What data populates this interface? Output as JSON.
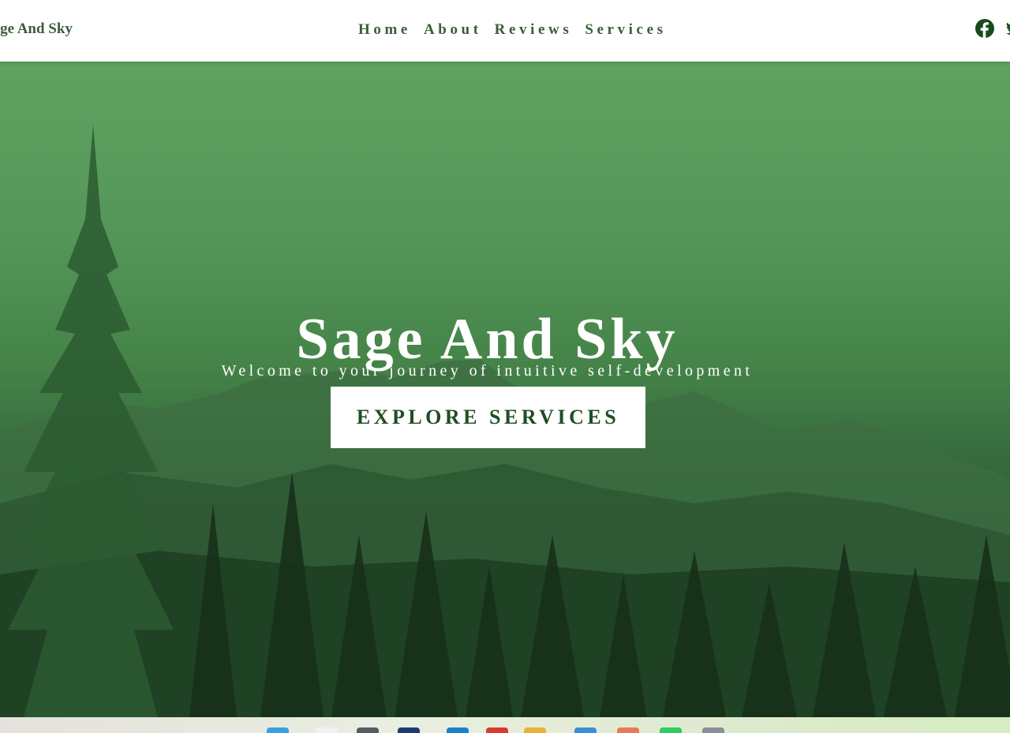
{
  "nav": {
    "brand": "Sage And Sky",
    "links": [
      {
        "label": "Home"
      },
      {
        "label": "About"
      },
      {
        "label": "Reviews"
      },
      {
        "label": "Services"
      }
    ],
    "social": [
      "facebook-icon",
      "twitter-icon"
    ]
  },
  "hero": {
    "title": "Sage And Sky",
    "subtitle": "Welcome to your journey of intuitive self-development",
    "cta_label": "EXPLORE SERVICES"
  },
  "colors": {
    "brand_green": "#3c5d3a",
    "cta_text": "#1f4d23",
    "hero_top": "#5ea25f",
    "hero_bottom": "#142a19"
  },
  "taskbar": {
    "icons": [
      "windows-start-icon",
      "file-icon",
      "taskview-icon",
      "store-icon",
      "edge-icon",
      "chrome-icon",
      "folder-icon",
      "mail-icon",
      "photos-icon",
      "spotify-icon",
      "settings-icon"
    ]
  }
}
